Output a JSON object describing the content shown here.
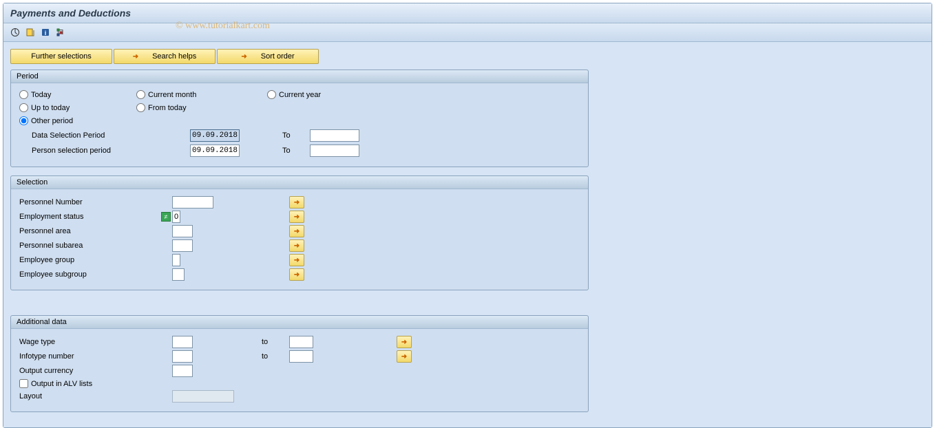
{
  "title": "Payments and Deductions",
  "watermark": "© www.tutorialkart.com",
  "actionButtons": {
    "further": "Further selections",
    "search": "Search helps",
    "sort": "Sort order"
  },
  "period": {
    "header": "Period",
    "today": "Today",
    "currentMonth": "Current month",
    "currentYear": "Current year",
    "upToToday": "Up to today",
    "fromToday": "From today",
    "otherPeriod": "Other period",
    "dataSelectionLabel": "Data Selection Period",
    "dataSelectionFrom": "09.09.2018",
    "personSelectionLabel": "Person selection period",
    "personSelectionFrom": "09.09.2018",
    "toLabel": "To"
  },
  "selection": {
    "header": "Selection",
    "personnelNumber": "Personnel Number",
    "employmentStatus": "Employment status",
    "employmentStatusValue": "0",
    "personnelArea": "Personnel area",
    "personnelSubarea": "Personnel subarea",
    "employeeGroup": "Employee group",
    "employeeSubgroup": "Employee subgroup"
  },
  "additional": {
    "header": "Additional data",
    "wageType": "Wage type",
    "infotypeNumber": "Infotype number",
    "outputCurrency": "Output currency",
    "outputAlv": "Output in ALV lists",
    "layout": "Layout",
    "toLabel": "to"
  }
}
